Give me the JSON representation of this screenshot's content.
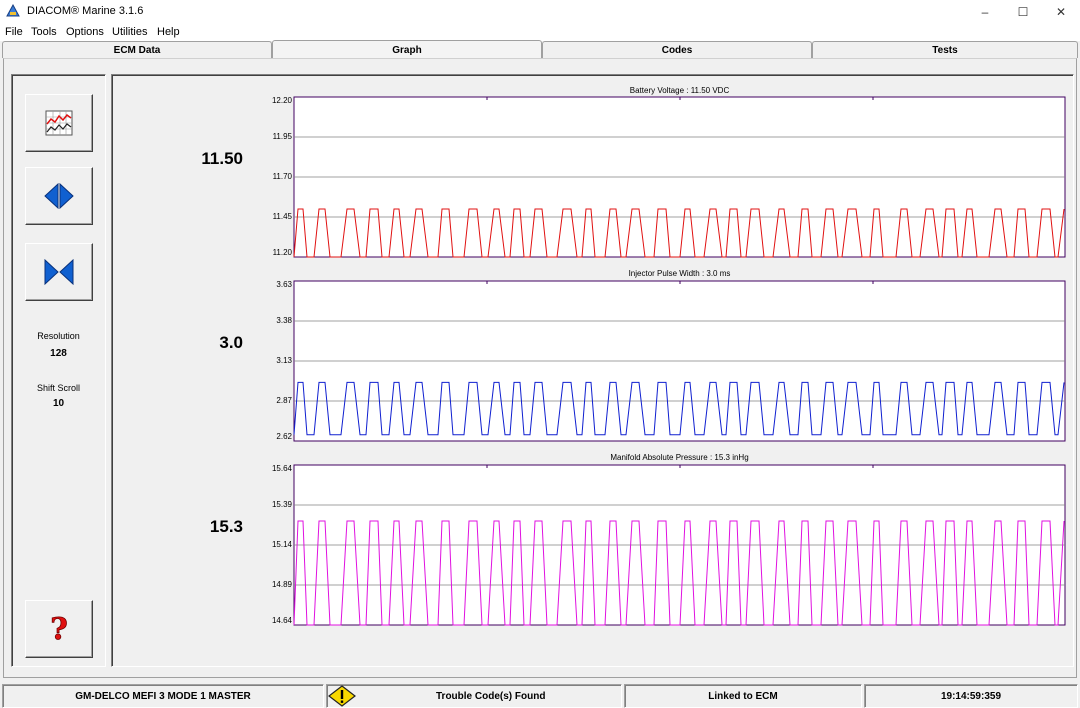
{
  "window": {
    "title": "DIACOM® Marine 3.1.6",
    "minimize": "–",
    "maximize": "☐",
    "close": "✕"
  },
  "menu": [
    "File",
    "Tools",
    "Options",
    "Utilities",
    "Help"
  ],
  "tabs": [
    {
      "label": "ECM Data",
      "active": false
    },
    {
      "label": "Graph",
      "active": true
    },
    {
      "label": "Codes",
      "active": false
    },
    {
      "label": "Tests",
      "active": false
    }
  ],
  "sidebar": {
    "buttons": [
      "graph-settings-icon",
      "expand-icon",
      "compress-icon",
      "help-icon"
    ],
    "resolution_label": "Resolution",
    "resolution_value": "128",
    "shift_label": "Shift Scroll",
    "shift_value": "10"
  },
  "graphs": [
    {
      "title": "Battery Voltage :  11.50 VDC",
      "value": "11.50",
      "ticks": [
        "12.20",
        "11.95",
        "11.70",
        "11.45",
        "11.20"
      ],
      "color": "#e01010",
      "low": 11.2,
      "high": 11.5,
      "ymin": 11.2,
      "ymax": 12.2
    },
    {
      "title": "Injector Pulse Width :  3.0 ms",
      "value": "3.0",
      "ticks": [
        "3.63",
        "3.38",
        "3.13",
        "2.87",
        "2.62"
      ],
      "color": "#1020d0",
      "low": 2.66,
      "high": 2.99,
      "ymin": 2.62,
      "ymax": 3.63
    },
    {
      "title": "Manifold Absolute Pressure :  15.3 inHg",
      "value": "15.3",
      "ticks": [
        "15.64",
        "15.39",
        "15.14",
        "14.89",
        "14.64"
      ],
      "color": "#e010e0",
      "low": 14.64,
      "high": 15.29,
      "ymin": 14.64,
      "ymax": 15.64
    }
  ],
  "status": {
    "ecm": "GM-DELCO MEFI 3 MODE 1 MASTER",
    "warning_icon": "warning-icon",
    "trouble": "Trouble Code(s) Found",
    "link": "Linked to ECM",
    "time": "19:14:59:359"
  }
}
